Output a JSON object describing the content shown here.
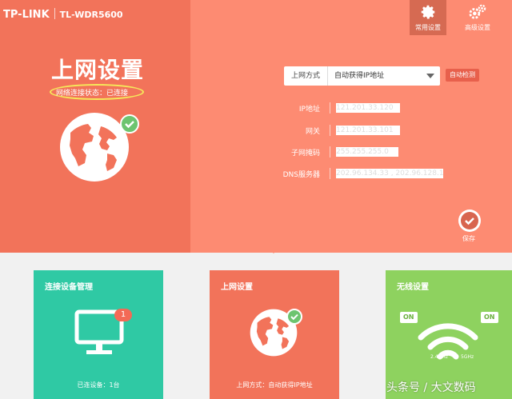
{
  "header": {
    "brand": "TP-LINK",
    "model": "TL-WDR5600",
    "nav": [
      {
        "label": "常用设置",
        "icon": "gear-icon",
        "active": true
      },
      {
        "label": "高级设置",
        "icon": "gears-icon",
        "active": false
      }
    ]
  },
  "main": {
    "title": "上网设置",
    "status": "网络连接状态：已连接",
    "connection": {
      "label": "上网方式",
      "value": "自动获得IP地址",
      "auto_detect": "自动检测"
    },
    "fields": [
      {
        "label": "IP地址",
        "value": "121.201.33.120"
      },
      {
        "label": "网关",
        "value": "121.201.33.101"
      },
      {
        "label": "子网掩码",
        "value": "255.255.255.0"
      },
      {
        "label": "DNS服务器",
        "value": "202.96.134.33 , 202.96.128.166"
      }
    ],
    "save_label": "保存"
  },
  "cards": [
    {
      "title": "连接设备管理",
      "footer": "已连设备：1台",
      "badge": "1",
      "color": "#2fc9a4"
    },
    {
      "title": "上网设置",
      "footer": "上网方式：自动获得IP地址",
      "color": "#f2735a"
    },
    {
      "title": "无线设置",
      "on_left": "ON",
      "on_right": "ON",
      "freq_left": "2.4GHz",
      "freq_right": "5GHz",
      "color": "#8ed25f"
    }
  ],
  "watermark": "头条号 / 大文数码"
}
